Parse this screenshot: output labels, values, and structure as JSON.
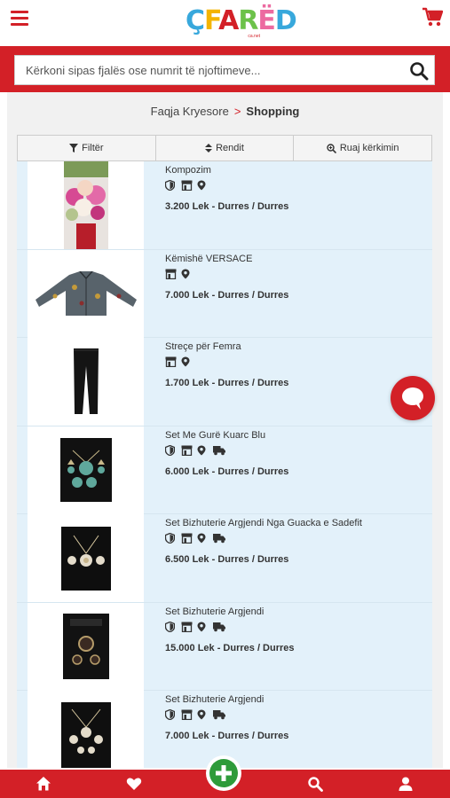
{
  "header": {
    "logo_text": "ÇFARËD",
    "logo_suffix": "ca.net",
    "menu_icon": "hamburger-icon",
    "cart_icon": "shopping-cart-icon"
  },
  "search": {
    "placeholder": "Kërkoni sipas fjalës ose numrit të njoftimeve...",
    "value": "",
    "icon": "search-icon"
  },
  "breadcrumb": {
    "home": "Faqja Kryesore",
    "separator": ">",
    "current": "Shopping"
  },
  "toolbar": {
    "filter_label": "Filtër",
    "sort_label": "Rendit",
    "save_label": "Ruaj kërkimin"
  },
  "listings": [
    {
      "title": "Kompozim",
      "price": "3.200 Lek - Durres / Durres",
      "icons": [
        "shield-icon",
        "store-icon",
        "location-pin-icon"
      ]
    },
    {
      "title": "Këmishë VERSACE",
      "price": "7.000 Lek - Durres / Durres",
      "icons": [
        "store-icon",
        "location-pin-icon"
      ]
    },
    {
      "title": "Streçe për Femra",
      "price": "1.700 Lek - Durres / Durres",
      "icons": [
        "store-icon",
        "location-pin-icon"
      ]
    },
    {
      "title": "Set Me Gurë Kuarc Blu",
      "price": "6.000 Lek - Durres / Durres",
      "icons": [
        "shield-icon",
        "store-icon",
        "location-pin-icon",
        "truck-icon"
      ]
    },
    {
      "title": "Set Bizhuterie Argjendi Nga Guacka e Sadefit",
      "price": "6.500 Lek - Durres / Durres",
      "icons": [
        "shield-icon",
        "store-icon",
        "location-pin-icon",
        "truck-icon"
      ]
    },
    {
      "title": "Set Bizhuterie Argjendi",
      "price": "15.000 Lek - Durres / Durres",
      "icons": [
        "shield-icon",
        "store-icon",
        "location-pin-icon",
        "truck-icon"
      ]
    },
    {
      "title": "Set Bizhuterie Argjendi",
      "price": "7.000 Lek - Durres / Durres",
      "icons": [
        "shield-icon",
        "store-icon",
        "location-pin-icon",
        "truck-icon"
      ]
    }
  ],
  "bottom_nav": {
    "items": [
      "home-icon",
      "heart-icon",
      "add-icon",
      "search-icon",
      "user-icon"
    ]
  },
  "colors": {
    "brand_red": "#d32027",
    "row_bg": "#e3f1fa",
    "add_green": "#2e9b3a"
  }
}
